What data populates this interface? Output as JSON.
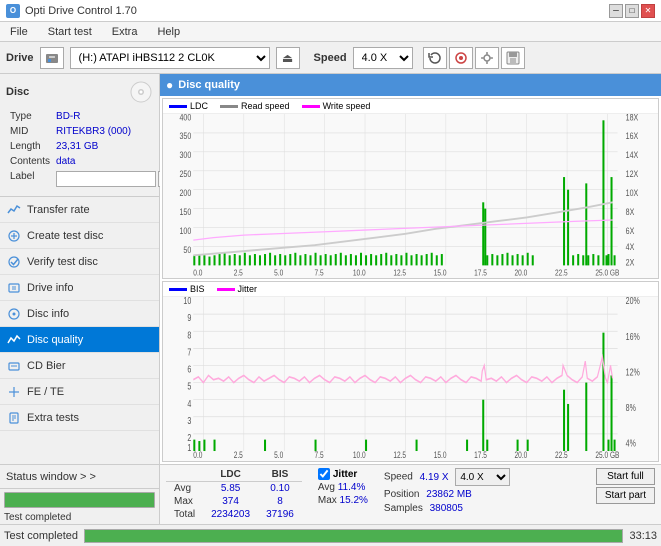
{
  "app": {
    "title": "Opti Drive Control 1.70",
    "icon_text": "O"
  },
  "title_bar": {
    "minimize_label": "─",
    "maximize_label": "□",
    "close_label": "✕"
  },
  "menu": {
    "items": [
      "File",
      "Start test",
      "Extra",
      "Help"
    ]
  },
  "drive_bar": {
    "label": "Drive",
    "drive_value": "(H:)  ATAPI iHBS112  2 CL0K",
    "speed_label": "Speed",
    "speed_value": "4.0 X",
    "eject_icon": "⏏"
  },
  "disc": {
    "title": "Disc",
    "type_label": "Type",
    "type_value": "BD-R",
    "mid_label": "MID",
    "mid_value": "RITEKBR3 (000)",
    "length_label": "Length",
    "length_value": "23,31 GB",
    "contents_label": "Contents",
    "contents_value": "data",
    "label_label": "Label",
    "label_value": "",
    "label_placeholder": ""
  },
  "sidebar": {
    "items": [
      {
        "id": "transfer-rate",
        "label": "Transfer rate",
        "active": false
      },
      {
        "id": "create-test-disc",
        "label": "Create test disc",
        "active": false
      },
      {
        "id": "verify-test-disc",
        "label": "Verify test disc",
        "active": false
      },
      {
        "id": "drive-info",
        "label": "Drive info",
        "active": false
      },
      {
        "id": "disc-info",
        "label": "Disc info",
        "active": false
      },
      {
        "id": "disc-quality",
        "label": "Disc quality",
        "active": true
      },
      {
        "id": "cd-bier",
        "label": "CD Bier",
        "active": false
      },
      {
        "id": "fe-te",
        "label": "FE / TE",
        "active": false
      },
      {
        "id": "extra-tests",
        "label": "Extra tests",
        "active": false
      }
    ]
  },
  "status_window": {
    "label": "Status window > >"
  },
  "disc_quality": {
    "title": "Disc quality",
    "icon": "●",
    "legend": {
      "ldc_label": "LDC",
      "read_speed_label": "Read speed",
      "write_speed_label": "Write speed",
      "bis_label": "BIS",
      "jitter_label": "Jitter"
    }
  },
  "stats": {
    "col_ldc": "LDC",
    "col_bis": "BIS",
    "row_avg": "Avg",
    "row_max": "Max",
    "row_total": "Total",
    "avg_ldc": "5.85",
    "avg_bis": "0.10",
    "max_ldc": "374",
    "max_bis": "8",
    "total_ldc": "2234203",
    "total_bis": "37196",
    "jitter_label": "Jitter",
    "avg_jitter": "11.4%",
    "max_jitter": "15.2%",
    "speed_label": "Speed",
    "speed_value": "4.19 X",
    "speed_select_value": "4.0 X",
    "position_label": "Position",
    "position_value": "23862 MB",
    "samples_label": "Samples",
    "samples_value": "380805",
    "start_full_label": "Start full",
    "start_part_label": "Start part"
  },
  "bottom": {
    "status_text": "Test completed",
    "progress_pct": 100,
    "progress_text": "100.0%",
    "time_text": "33:13"
  },
  "chart1": {
    "y_axis": [
      "400",
      "350",
      "300",
      "250",
      "200",
      "150",
      "100",
      "50"
    ],
    "y_axis_right": [
      "18X",
      "16X",
      "14X",
      "12X",
      "10X",
      "8X",
      "6X",
      "4X",
      "2X"
    ],
    "x_axis": [
      "0.0",
      "2.5",
      "5.0",
      "7.5",
      "10.0",
      "12.5",
      "15.0",
      "17.5",
      "20.0",
      "22.5",
      "25.0 GB"
    ]
  },
  "chart2": {
    "y_axis": [
      "10",
      "9",
      "8",
      "7",
      "6",
      "5",
      "4",
      "3",
      "2",
      "1"
    ],
    "y_axis_right": [
      "20%",
      "16%",
      "12%",
      "8%",
      "4%"
    ],
    "x_axis": [
      "0.0",
      "2.5",
      "5.0",
      "7.5",
      "10.0",
      "12.5",
      "15.0",
      "17.5",
      "20.0",
      "22.5",
      "25.0 GB"
    ]
  }
}
